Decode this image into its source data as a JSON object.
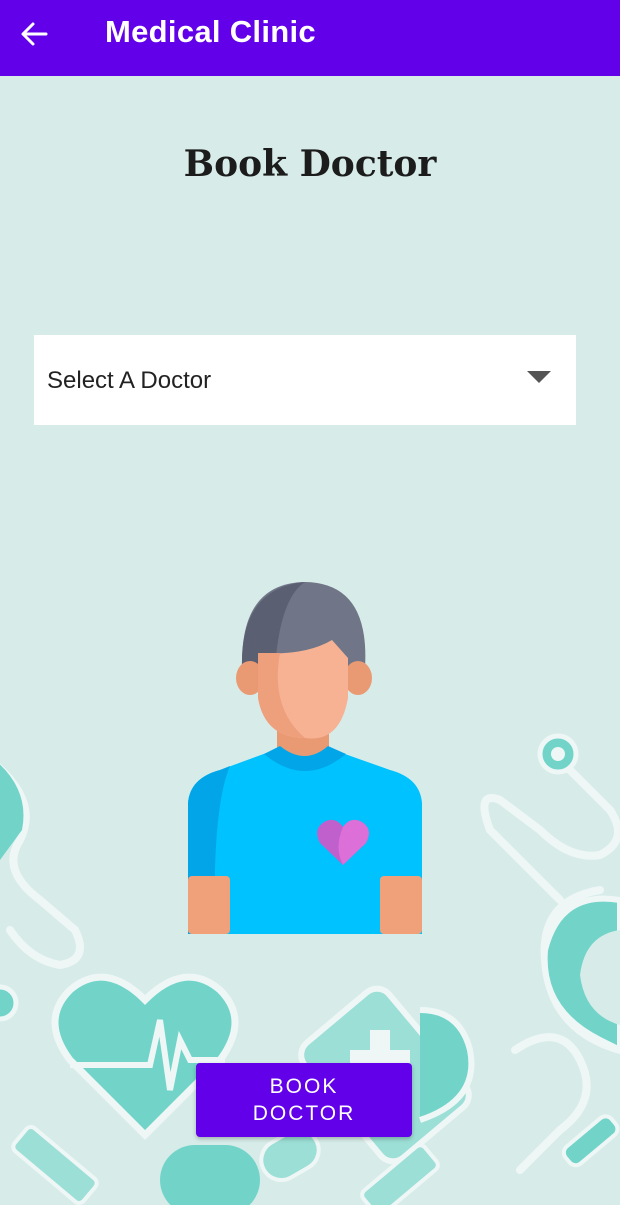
{
  "appbar": {
    "title": "Medical Clinic",
    "back_icon": "arrow-left-icon"
  },
  "page": {
    "title": "Book Doctor"
  },
  "doctor_select": {
    "value": "Select A Doctor",
    "icon": "chevron-down-icon"
  },
  "actions": {
    "book_label": "BOOK DOCTOR"
  },
  "colors": {
    "primary": "#6200ea",
    "background": "#d7ece9",
    "accent": "#72d4c9"
  }
}
